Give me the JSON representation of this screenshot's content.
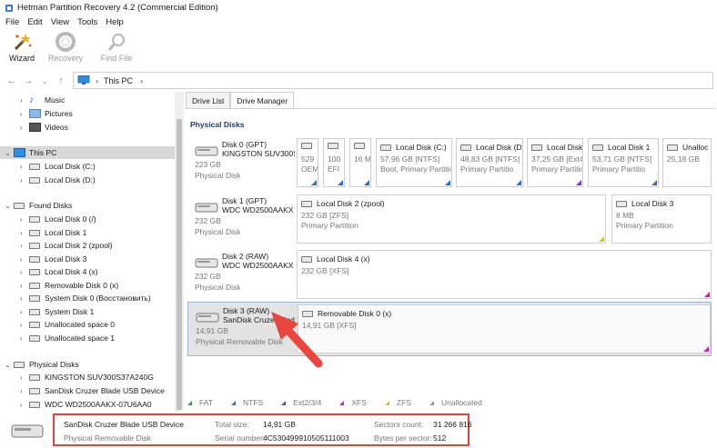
{
  "window": {
    "title": "Hetman Partition Recovery 4.2 (Commercial Edition)"
  },
  "menu": [
    "File",
    "Edit",
    "View",
    "Tools",
    "Help"
  ],
  "toolbar": {
    "wizard": "Wizard",
    "recovery": "Recovery",
    "find_file": "Find File"
  },
  "address": {
    "path": "This PC"
  },
  "tree": {
    "music": "Music",
    "pictures": "Pictures",
    "videos": "Videos",
    "this_pc": "This PC",
    "local_c": "Local Disk (C:)",
    "local_d": "Local Disk (D:)",
    "found_disks": "Found Disks",
    "found": [
      "Local Disk 0 (/)",
      "Local Disk 1",
      "Local Disk 2 (zpool)",
      "Local Disk 3",
      "Local Disk 4 (x)",
      "Removable Disk 0 (x)",
      "System Disk 0 (Восстановить)",
      "System Disk 1",
      "Unallocated space 0",
      "Unallocated space 1"
    ],
    "physical_disks": "Physical Disks",
    "physical": [
      "KINGSTON SUV300S37A240G",
      "SanDisk Cruzer Blade USB Device",
      "WDC WD2500AAKX-07U6AA0"
    ]
  },
  "tabs": {
    "drive_list": "Drive List",
    "drive_manager": "Drive Manager"
  },
  "section_title": "Physical Disks",
  "disks": [
    {
      "name": "Disk 0 (GPT)",
      "model": "KINGSTON SUV300S",
      "size": "223 GB",
      "kind": "Physical Disk",
      "partitions": [
        {
          "name": "",
          "line1": "529",
          "line2": "OEM",
          "corner": "#2a6fd1"
        },
        {
          "name": "",
          "line1": "100",
          "line2": "EFI",
          "corner": "#2a6fd1"
        },
        {
          "name": "",
          "line1": "16 M",
          "line2": "",
          "corner": "#2a6fd1"
        },
        {
          "name": "Local Disk (C:)",
          "line1": "57,96 GB [NTFS]",
          "line2": "Boot, Primary Partitio",
          "corner": "#2a6fd1"
        },
        {
          "name": "Local Disk (D",
          "line1": "48,83 GB [NTFS]",
          "line2": "Primary Partitio",
          "corner": "#2a6fd1"
        },
        {
          "name": "Local Disk",
          "line1": "37,25 GB [Ext4",
          "line2": "Primary Partitio",
          "corner": "#7a3fbf"
        },
        {
          "name": "Local Disk 1",
          "line1": "53,71 GB [NTFS]",
          "line2": "Primary Partitio",
          "corner": "#2a6fd1"
        },
        {
          "name": "Unalloc",
          "line1": "25,18 GB",
          "line2": "",
          "corner": ""
        }
      ]
    },
    {
      "name": "Disk 1 (GPT)",
      "model": "WDC WD2500AAKX",
      "size": "232 GB",
      "kind": "Physical Disk",
      "partitions": [
        {
          "name": "Local Disk 2 (zpool)",
          "line1": "232 GB [ZFS]",
          "line2": "Primary Partition",
          "corner": "#e8c000"
        },
        {
          "name": "Local Disk 3",
          "line1": "8 MB",
          "line2": "Primary Partition",
          "corner": ""
        }
      ]
    },
    {
      "name": "Disk 2 (RAW)",
      "model": "WDC WD2500AAKX",
      "size": "232 GB",
      "kind": "Physical Disk",
      "partitions": [
        {
          "name": "Local Disk 4 (x)",
          "line1": "232 GB [XFS]",
          "line2": "",
          "corner": "#c020c0"
        }
      ]
    },
    {
      "name": "Disk 3 (RAW)",
      "model": "SanDisk Cruzer Blad",
      "size": "14,91 GB",
      "kind": "Physical Removable Disk",
      "partitions": [
        {
          "name": "Removable Disk 0 (x)",
          "line1": "14,91 GB [XFS]",
          "line2": "",
          "corner": "#c020c0"
        }
      ]
    }
  ],
  "legend": [
    {
      "label": "FAT",
      "color": "#2a9d4b"
    },
    {
      "label": "NTFS",
      "color": "#2a6fd1"
    },
    {
      "label": "Ext2/3/4",
      "color": "#7a3fbf"
    },
    {
      "label": "XFS",
      "color": "#c020c0"
    },
    {
      "label": "ZFS",
      "color": "#e8c000"
    },
    {
      "label": "Unallocated",
      "color": "#999999"
    }
  ],
  "status": {
    "device_name": "SanDisk Cruzer Blade USB Device",
    "device_kind": "Physical Removable Disk",
    "total_size_label": "Total size:",
    "total_size": "14,91 GB",
    "serial_label": "Serial number:",
    "serial": "4C530499910505111003",
    "sectors_label": "Sectors count:",
    "sectors": "31 266 816",
    "bps_label": "Bytes per sector:",
    "bps": "512"
  },
  "colors": {
    "annotation_red": "#e0403a",
    "selection": "#d8d8d8"
  }
}
